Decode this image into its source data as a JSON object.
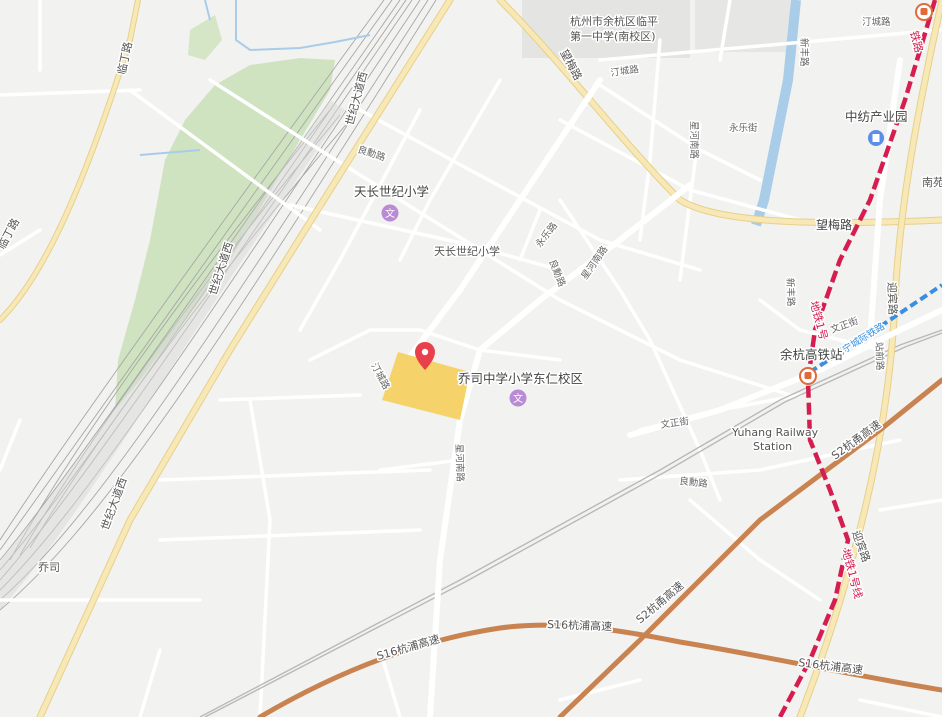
{
  "roads": {
    "shiji_dadao_1": "世纪大道西",
    "shiji_dadao_2": "世纪大道西",
    "shiji_dadao_3": "世纪大道西",
    "lingding_1": "临丁路",
    "lingding_2": "临丁路",
    "wangmei_1": "望梅路",
    "wangmei_2": "望梅路",
    "tingcheng_1": "汀城路",
    "tingcheng_2": "汀城路",
    "tingcheng_3": "汀城路",
    "liangxun_1": "良勳路",
    "liangxun_2": "良勳路",
    "liangxun_3": "良勳路",
    "yongle_1": "永乐路",
    "yongle_2": "永乐街",
    "xinghe_1": "星河南路",
    "xinghe_2": "星河南路",
    "xinghe_3": "星河南路",
    "xinfeng_1": "新丰路",
    "xinfeng_2": "新丰路",
    "yingbin_1": "迎宾路",
    "yingbin_2": "迎宾路",
    "wenzheng_1": "文正街",
    "wenzheng_2": "文正街",
    "zhanqian": "站前路",
    "s2_1": "S2杭甬高速",
    "s2_2": "S2杭甬高速",
    "s16_1": "S16杭浦高速",
    "s16_2": "S16杭浦高速",
    "s16_3": "S16杭浦高速",
    "metro_1": "地铁1号",
    "metro_2": "地铁1号线",
    "metro_top": "铁路",
    "haining": "海宁城际铁路"
  },
  "places": {
    "school_top_line1": "杭州市余杭区临平",
    "school_top_line2": "第一中学(南校区)",
    "tianchang_poi": "天长世纪小学",
    "tianchang_area": "天长世纪小学",
    "qiaosi_school": "乔司中学小学东仁校区",
    "zhongfang": "中纺产业园",
    "nanyuan": "南苑",
    "yuhang_station": "余杭高铁站",
    "railway_station_en_1": "Yuhang Railway",
    "railway_station_en_2": "Station",
    "qiaosi": "乔司"
  },
  "colors": {
    "background": "#f2f2f0",
    "road": "#ffffff",
    "major_road": "#f7e8b6",
    "major_road_edge": "#e6d08d",
    "highway": "#c98350",
    "metro": "#d51d4f",
    "intercity": "#3a8fe0",
    "water": "#a9cce8",
    "green": "#cfe3c1",
    "highlight_area": "#f6d36a",
    "marker": "#e8414b",
    "school_icon": "#b98bd6"
  },
  "icons": {
    "marker": "location-pin-icon",
    "school": "school-icon",
    "train": "train-station-icon",
    "building": "building-icon"
  }
}
